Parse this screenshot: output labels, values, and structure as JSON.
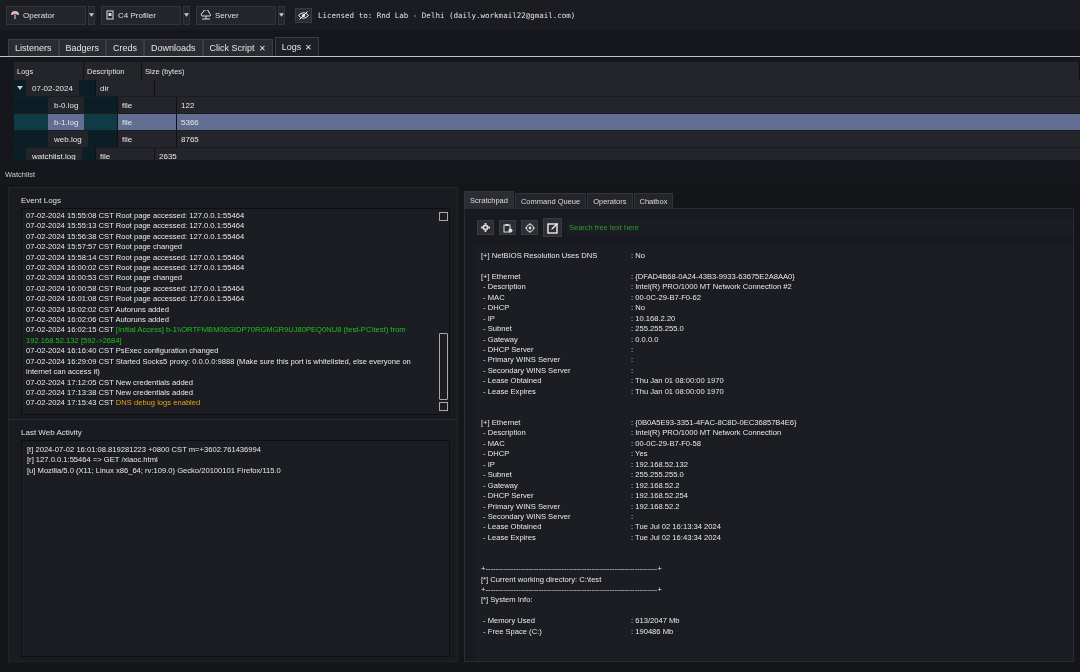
{
  "toolbar": {
    "dropdowns": [
      {
        "label": "Operator"
      },
      {
        "label": "C4 Profiler"
      },
      {
        "label": "Server"
      }
    ],
    "license": "Licensed to: Rnd Lab - Delhi (daily.workmail22@gmail.com)"
  },
  "tabs": [
    {
      "label": "Listeners",
      "selected": false
    },
    {
      "label": "Badgers",
      "selected": false
    },
    {
      "label": "Creds",
      "selected": false
    },
    {
      "label": "Downloads",
      "selected": false
    },
    {
      "label": "Click Script",
      "selected": false,
      "close": "✕"
    },
    {
      "label": "Logs",
      "selected": true,
      "close": "✕"
    }
  ],
  "table": {
    "columns": [
      "Logs",
      "Description",
      "Size (bytes)"
    ],
    "rows": [
      {
        "name": "07-02-2024",
        "description": "dir",
        "size": "",
        "selected": false,
        "expanded": true,
        "children": [
          {
            "name": "b-0.log",
            "description": "file",
            "size": "122",
            "selected": false
          },
          {
            "name": "b-1.log",
            "description": "file",
            "size": "5366",
            "selected": true
          },
          {
            "name": "web.log",
            "description": "file",
            "size": "8765",
            "selected": false
          }
        ]
      },
      {
        "name": "watchlist.log",
        "description": "file",
        "size": "2635",
        "selected": false
      }
    ]
  },
  "watchlist": {
    "title": "Watchlist",
    "event_logs": {
      "title": "Event Logs",
      "entries": [
        {
          "time": "07-02-2024 15:55:08 CST",
          "message": "Root page accessed: 127.0.0.1:55464",
          "kind": "normal"
        },
        {
          "time": "07-02-2024 15:55:13 CST",
          "message": "Root page accessed: 127.0.0.1:55464",
          "kind": "normal"
        },
        {
          "time": "07-02-2024 15:56:38 CST",
          "message": "Root page accessed: 127.0.0.1:55464",
          "kind": "normal"
        },
        {
          "time": "07-02-2024 15:57:57 CST",
          "message": "Root page changed",
          "kind": "normal"
        },
        {
          "time": "07-02-2024 15:58:14 CST",
          "message": "Root page accessed: 127.0.0.1:55464",
          "kind": "normal"
        },
        {
          "time": "07-02-2024 16:00:02 CST",
          "message": "Root page accessed: 127.0.0.1:55464",
          "kind": "normal"
        },
        {
          "time": "07-02-2024 16:00:53 CST",
          "message": "Root page changed",
          "kind": "normal"
        },
        {
          "time": "07-02-2024 16:00:58 CST",
          "message": "Root page accessed: 127.0.0.1:55464",
          "kind": "normal"
        },
        {
          "time": "07-02-2024 16:01:08 CST",
          "message": "Root page accessed: 127.0.0.1:55464",
          "kind": "normal"
        },
        {
          "time": "07-02-2024 16:02:02 CST",
          "message": "Autoruns added",
          "kind": "normal"
        },
        {
          "time": "07-02-2024 16:02:06 CST",
          "message": "Autoruns added",
          "kind": "normal"
        },
        {
          "time": "07-02-2024 16:02:15 CST",
          "message": "[Initial Access] b-1\\\\ORTFMBM08GIDP70RGMGR9UJ80PEQ0NU8 (test-PC\\test) from 192.168.52.132 [592->2684]",
          "kind": "success"
        },
        {
          "time": "07-02-2024 16:16:40 CST",
          "message": "PsExec configuration changed",
          "kind": "normal"
        },
        {
          "time": "07-02-2024 16:29:09 CST",
          "message": "Started Socks5 proxy: 0.0.0.0:9888 (Make sure this port is whitelisted, else everyone on internet can access it)",
          "kind": "normal"
        },
        {
          "time": "07-02-2024 17:12:05 CST",
          "message": "New credentials added",
          "kind": "normal"
        },
        {
          "time": "07-02-2024 17:13:38 CST",
          "message": "New credentials added",
          "kind": "normal"
        },
        {
          "time": "07-02-2024 17:15:43 CST",
          "message": "DNS debug logs enabled",
          "kind": "warning"
        }
      ]
    },
    "web_activity": {
      "title": "Last Web Activity",
      "lines": [
        "[t] 2024-07-02 16:01:08.819281223 +0800 CST m=+3602.761436994",
        "[r] 127.0.0.1:55464 => GET /xiaoc.html",
        "[u] Mozilla/5.0 (X11; Linux x86_64; rv:109.0) Gecko/20100101 Firefox/115.0"
      ]
    }
  },
  "side_tabs": [
    {
      "label": "Scratchpad",
      "selected": true
    },
    {
      "label": "Command Queue",
      "selected": false
    },
    {
      "label": "Operators",
      "selected": false
    },
    {
      "label": "Chatbox",
      "selected": false
    }
  ],
  "scratchpad": {
    "search": {
      "placeholder": "Search free text here"
    },
    "lines": [
      {
        "kind": "field",
        "label": "[+] NetBIOS Resolution Uses DNS",
        "value": ": No"
      },
      {
        "kind": "blank"
      },
      {
        "kind": "field",
        "label": "[+] Ethernet",
        "value": ": {DFAD4B68-0A24-43B3-9933-63675E2A8AA0}"
      },
      {
        "kind": "field",
        "label": " - Description",
        "value": ": Intel(R) PRO/1000 MT Network Connection #2"
      },
      {
        "kind": "field",
        "label": " - MAC",
        "value": ": 00-0C-29-B7-F0-62"
      },
      {
        "kind": "field",
        "label": " - DHCP",
        "value": ": No"
      },
      {
        "kind": "field",
        "label": " - IP",
        "value": ": 10.168.2.20"
      },
      {
        "kind": "field",
        "label": " - Subnet",
        "value": ": 255.255.255.0"
      },
      {
        "kind": "field",
        "label": " - Gateway",
        "value": ": 0.0.0.0"
      },
      {
        "kind": "field",
        "label": " - DHCP Server",
        "value": ":"
      },
      {
        "kind": "field",
        "label": " - Primary WINS Server",
        "value": ":"
      },
      {
        "kind": "field",
        "label": " - Secondary WINS Server",
        "value": ":"
      },
      {
        "kind": "field",
        "label": " - Lease Obtained",
        "value": ": Thu Jan 01 08:00:00 1970"
      },
      {
        "kind": "field",
        "label": " - Lease Expires",
        "value": ": Thu Jan 01 08:00:00 1970"
      },
      {
        "kind": "blank"
      },
      {
        "kind": "blank"
      },
      {
        "kind": "field",
        "label": "[+] Ethernet",
        "value": ": {0B0A5E93-3351-4FAC-8C8D-0EC36857B4E6}"
      },
      {
        "kind": "field",
        "label": " - Description",
        "value": ": Intel(R) PRO/1000 MT Network Connection"
      },
      {
        "kind": "field",
        "label": " - MAC",
        "value": ": 00-0C-29-B7-F0-58"
      },
      {
        "kind": "field",
        "label": " - DHCP",
        "value": ": Yes"
      },
      {
        "kind": "field",
        "label": " - IP",
        "value": ": 192.168.52.132"
      },
      {
        "kind": "field",
        "label": " - Subnet",
        "value": ": 255.255.255.0"
      },
      {
        "kind": "field",
        "label": " - Gateway",
        "value": ": 192.168.52.2"
      },
      {
        "kind": "field",
        "label": " - DHCP Server",
        "value": ": 192.168.52.254"
      },
      {
        "kind": "field",
        "label": " - Primary WINS Server",
        "value": ": 192.168.52.2"
      },
      {
        "kind": "field",
        "label": " - Secondary WINS Server",
        "value": ":"
      },
      {
        "kind": "field",
        "label": " - Lease Obtained",
        "value": ": Tue Jul 02 16:13:34 2024"
      },
      {
        "kind": "field",
        "label": " - Lease Expires",
        "value": ": Tue Jul 02 16:43:34 2024"
      },
      {
        "kind": "blank"
      },
      {
        "kind": "blank"
      },
      {
        "kind": "text",
        "text": "+--------------------------------------------------------------------+"
      },
      {
        "kind": "text",
        "text": "[*] Current working directory: C:\\test"
      },
      {
        "kind": "text",
        "text": "+--------------------------------------------------------------------+"
      },
      {
        "kind": "text",
        "text": "[*] System Info:"
      },
      {
        "kind": "blank"
      },
      {
        "kind": "field",
        "label": " - Memory Used",
        "value": ": 613/2047 Mb"
      },
      {
        "kind": "field",
        "label": " - Free Space (C:)",
        "value": ": 190486 Mb"
      }
    ]
  }
}
